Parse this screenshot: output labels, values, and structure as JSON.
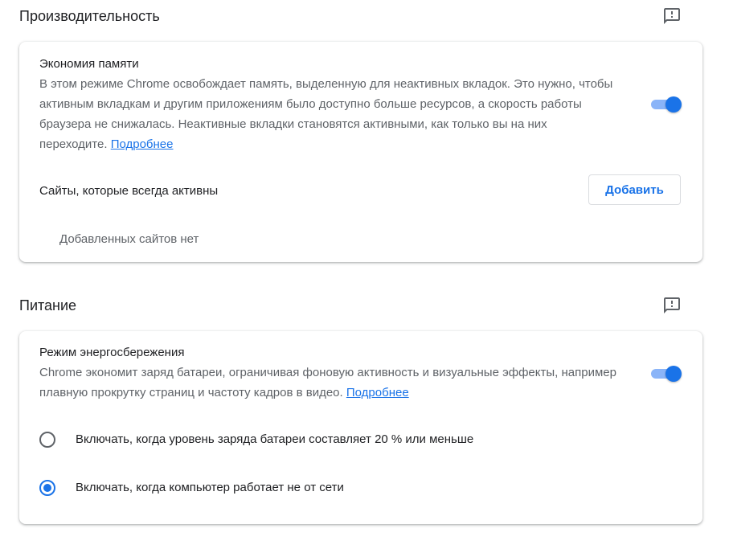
{
  "performance": {
    "title": "Производительность",
    "memory_saver": {
      "title": "Экономия памяти",
      "description": "В этом режиме Chrome освобождает память, выделенную для неактивных вкладок. Это нужно, чтобы активным вкладкам и другим приложениям было доступно больше ресурсов, а скорость работы браузера не снижалась. Неактивные вкладки становятся активными, как только вы на них переходите.",
      "learn_more": "Подробнее",
      "enabled": true
    },
    "always_active": {
      "label": "Сайты, которые всегда активны",
      "add_button": "Добавить",
      "empty_text": "Добавленных сайтов нет"
    }
  },
  "power": {
    "title": "Питание",
    "energy_saver": {
      "title": "Режим энергосбережения",
      "description": "Chrome экономит заряд батареи, ограничивая фоновую активность и визуальные эффекты, например плавную прокрутку страниц и частоту кадров в видео.",
      "learn_more": "Подробнее",
      "enabled": true
    },
    "options": [
      {
        "label": "Включать, когда уровень заряда батареи составляет 20 % или меньше",
        "checked": false
      },
      {
        "label": "Включать, когда компьютер работает не от сети",
        "checked": true
      }
    ]
  },
  "colors": {
    "accent": "#1a73e8",
    "toggle_track": "#8ab4f8",
    "secondary_text": "#5f6368"
  }
}
